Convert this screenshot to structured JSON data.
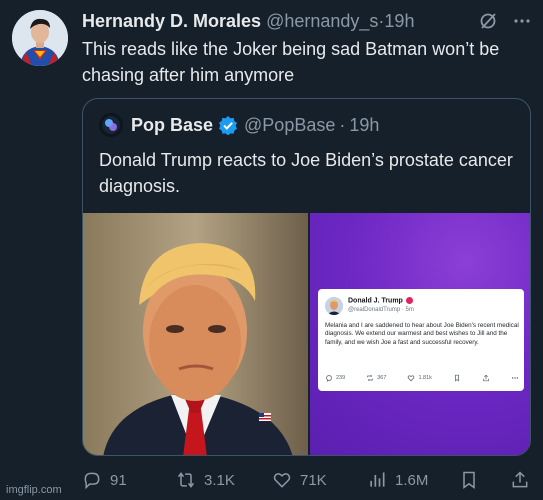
{
  "tweet": {
    "author": {
      "display_name": "Hernandy D. Morales",
      "handle": "@hernandy_s",
      "separator": "·",
      "time": "19h",
      "avatar_icon": "superman-avatar"
    },
    "text": "This reads like the Joker being sad Batman won’t be chasing after him anymore",
    "header_icons": [
      "grok-icon",
      "more-icon"
    ]
  },
  "quote": {
    "author": {
      "display_name": "Pop Base",
      "handle": "@PopBase",
      "separator": "·",
      "time": "19h",
      "verified": true
    },
    "text": "Donald Trump reacts to Joe Biden’s prostate cancer diagnosis.",
    "media": {
      "left_image": "portrait-photo",
      "right_image": "truth-social-post-screenshot",
      "embedded_post": {
        "name": "Donald J. Trump",
        "handle": "@realDonaldTrump · 5m",
        "body": "Melania and I are saddened to hear about Joe Biden's recent medical diagnosis. We extend our warmest and best wishes to Jill and the family, and we wish Joe a fast and successful recovery.",
        "replies": "239",
        "retruths": "367",
        "likes": "1.81k"
      }
    }
  },
  "actions": {
    "replies": "91",
    "reposts": "3.1K",
    "likes": "71K",
    "views": "1.6M"
  },
  "watermark": "imgflip.com",
  "colors": {
    "background": "#15202b",
    "text_primary": "#e7e9ea",
    "text_secondary": "#8b98a5",
    "border": "#3d5466",
    "verified": "#1d9bf0",
    "panel_purple": "#6e28c4"
  }
}
